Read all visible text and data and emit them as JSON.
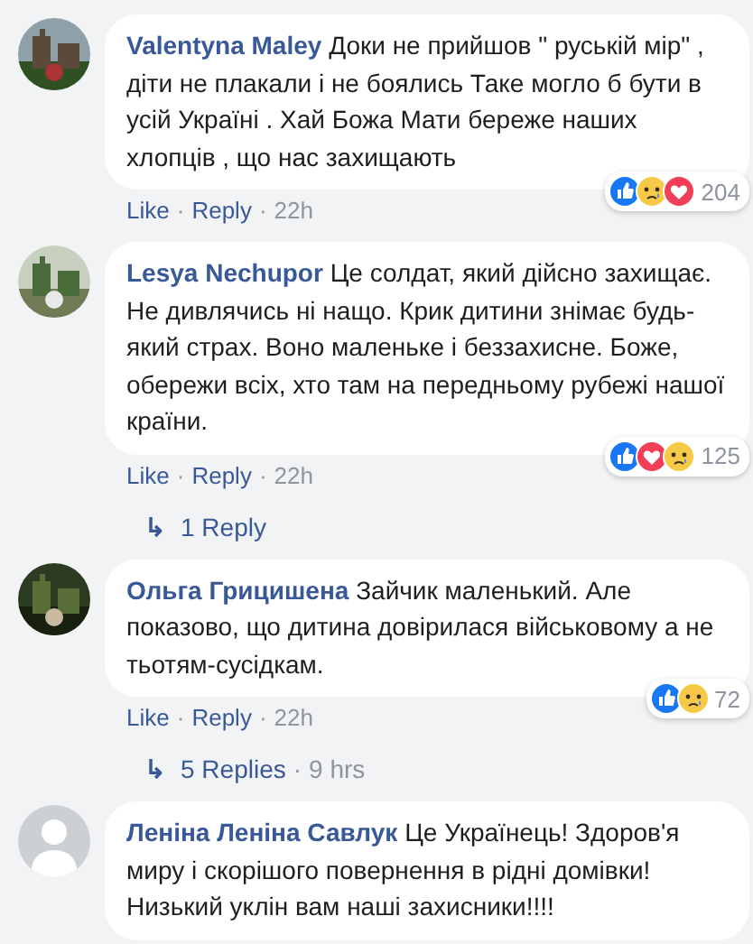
{
  "comments": [
    {
      "author": "Valentyna Maley",
      "avatar": {
        "kind": "picture"
      },
      "text": "Доки не прийшов \" руській мір\" , діти не плакали і не боялись Таке могло б бути в усій Україні . Хай Божа Мати береже наших хлопців , що нас захищають",
      "actions": [
        {
          "kind": "like",
          "text": "Like"
        },
        {
          "kind": "separator",
          "text": "·"
        },
        {
          "kind": "reply",
          "text": "Reply"
        },
        {
          "kind": "separator",
          "text": "·"
        },
        {
          "kind": "time",
          "text": "22h"
        }
      ],
      "reactions": [
        {
          "kind": "like"
        },
        {
          "kind": "sad"
        },
        {
          "kind": "love"
        }
      ],
      "reaction_count": "204"
    },
    {
      "author": "Lesya Nechupor",
      "avatar": {
        "kind": "picture"
      },
      "text": "Це солдат, який дійсно захищає. Не дивлячись ні нащо. Крик дитини знімає будь-який страх. Воно маленьке і беззахисне. Боже, обережи всіх, хто там на передньому рубежі нашої країни.",
      "actions": [
        {
          "kind": "like",
          "text": "Like"
        },
        {
          "kind": "separator",
          "text": "·"
        },
        {
          "kind": "reply",
          "text": "Reply"
        },
        {
          "kind": "separator",
          "text": "·"
        },
        {
          "kind": "time",
          "text": "22h"
        }
      ],
      "reactions": [
        {
          "kind": "like"
        },
        {
          "kind": "love"
        },
        {
          "kind": "sad"
        }
      ],
      "reaction_count": "125",
      "replies": [
        {
          "kind": "arrow",
          "text": "↳"
        },
        {
          "kind": "link",
          "text": "1 Reply"
        }
      ]
    },
    {
      "author": "Ольга Грицишена",
      "avatar": {
        "kind": "picture"
      },
      "text": "Зайчик маленький. Але показово, що дитина довірилася військовому а не тьотям-сусідкам.",
      "actions": [
        {
          "kind": "like",
          "text": "Like"
        },
        {
          "kind": "separator",
          "text": "·"
        },
        {
          "kind": "reply",
          "text": "Reply"
        },
        {
          "kind": "separator",
          "text": "·"
        },
        {
          "kind": "time",
          "text": "22h"
        }
      ],
      "reactions": [
        {
          "kind": "like"
        },
        {
          "kind": "sad"
        }
      ],
      "reaction_count": "72",
      "replies": [
        {
          "kind": "arrow",
          "text": "↳"
        },
        {
          "kind": "link",
          "text": "5 Replies"
        },
        {
          "kind": "separator",
          "text": "·"
        },
        {
          "kind": "time",
          "text": "9 hrs"
        }
      ]
    },
    {
      "author": "Леніна Леніна Савлук",
      "avatar": {
        "kind": "silhouette"
      },
      "text": "Це Українець! Здоров'я миру і скорішого повернення в рідні домівки! Низький уклін вам наші захисники!!!!"
    }
  ]
}
